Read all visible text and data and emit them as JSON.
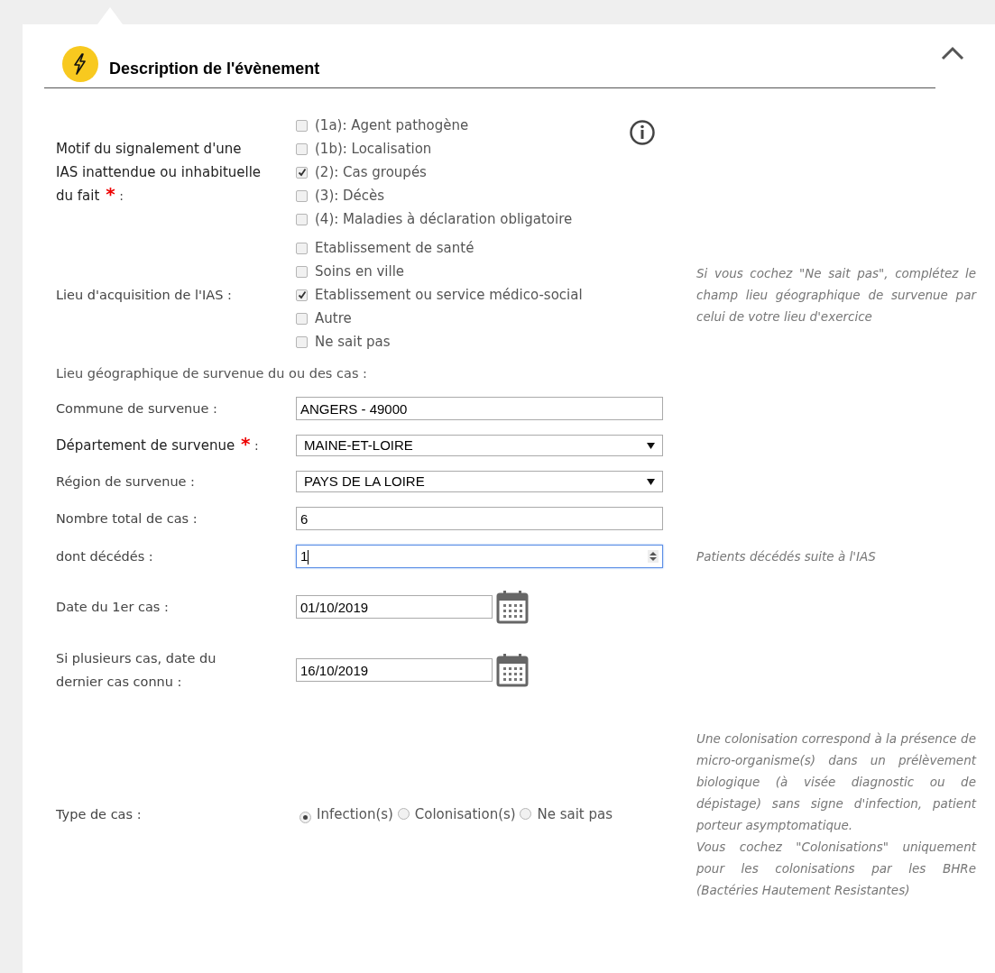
{
  "section": {
    "title": "Description de l'évènement",
    "expanded": true
  },
  "rows": [
    {
      "kind": "checkboxes",
      "label": "Motif du signalement d'une IAS inattendue ou inhabituelle du fait",
      "required_mark": "*",
      "suffix": ":",
      "info": true,
      "options": [
        {
          "label": "(1a): Agent pathogène",
          "checked": false
        },
        {
          "label": "(1b): Localisation",
          "checked": false
        },
        {
          "label": "(2): Cas groupés",
          "checked": true
        },
        {
          "label": "(3): Décès",
          "checked": false
        },
        {
          "label": "(4): Maladies à déclaration obligatoire",
          "checked": false
        }
      ]
    },
    {
      "kind": "checkboxes",
      "label": "Lieu d'acquisition de l'IAS :",
      "hint": [
        "Si vous cochez \"Ne sait pas\", complétez le champ lieu géographique de survenue par celui de votre lieu d'exercice"
      ],
      "options": [
        {
          "label": "Etablissement de santé",
          "checked": false
        },
        {
          "label": "Soins en ville",
          "checked": false
        },
        {
          "label": "Etablissement ou service médico-social",
          "checked": true
        },
        {
          "label": "Autre",
          "checked": false
        },
        {
          "label": "Ne sait pas",
          "checked": false
        }
      ]
    },
    {
      "kind": "heading",
      "label": "Lieu géographique de survenue du ou des cas :"
    },
    {
      "kind": "text",
      "label": "Commune de survenue :",
      "value": "ANGERS - 49000"
    },
    {
      "kind": "select",
      "label": "Département de survenue",
      "required_mark": "*",
      "suffix": ":",
      "value": "MAINE-ET-LOIRE"
    },
    {
      "kind": "select",
      "label": "Région de survenue :",
      "value": "PAYS DE LA LOIRE"
    },
    {
      "kind": "text",
      "label": "Nombre total de cas :",
      "value": "6"
    },
    {
      "kind": "number",
      "label": "dont décédés :",
      "value": "1",
      "focused": true,
      "hint": [
        "Patients décédés suite à l'IAS"
      ]
    },
    {
      "kind": "date",
      "label": "Date du 1er cas :",
      "value": "01/10/2019"
    },
    {
      "kind": "date",
      "label": "Si plusieurs cas, date du dernier cas connu :",
      "value": "16/10/2019"
    },
    {
      "kind": "radios",
      "label": "Type de cas :",
      "hint": [
        "Une colonisation correspond à la présence de micro-organisme(s) dans un prélèvement biologique (à visée diagnostic ou de dépistage) sans signe d'infection, patient porteur asymptomatique.",
        "Vous cochez \"Colonisations\" uniquement pour les colonisations par les BHRe (Bactéries Hautement Resistantes)"
      ],
      "options": [
        {
          "label": "Infection(s)",
          "selected": true
        },
        {
          "label": "Colonisation(s)",
          "selected": false
        },
        {
          "label": "Ne sait pas",
          "selected": false
        }
      ]
    }
  ]
}
